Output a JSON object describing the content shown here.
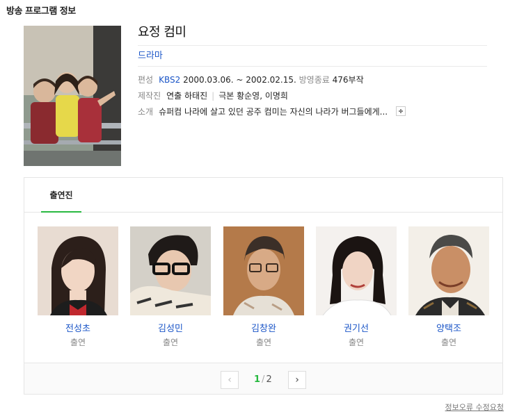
{
  "section_title": "방송 프로그램 정보",
  "program": {
    "title": "요정 컴미",
    "genre": "드라마",
    "broadcast": {
      "label": "편성",
      "channel": "KBS2",
      "period": "2000.03.06. ~ 2002.02.15.",
      "status": "방영종료",
      "episodes": "476부작"
    },
    "production": {
      "label": "제작진",
      "director": "연출 하태진",
      "writer": "극본 황순영, 이명희"
    },
    "synopsis": {
      "label": "소개",
      "text": "슈퍼컴 나라에 살고 있던 공주 컴미는 자신의 나라가 버그들에게..."
    }
  },
  "cast": {
    "tab_label": "출연진",
    "members": [
      {
        "name": "전성초",
        "role": "출연"
      },
      {
        "name": "김성민",
        "role": "출연"
      },
      {
        "name": "김창완",
        "role": "출연"
      },
      {
        "name": "권기선",
        "role": "출연"
      },
      {
        "name": "양택조",
        "role": "출연"
      }
    ],
    "pagination": {
      "current": "1",
      "separator": "/",
      "total": "2",
      "prev": "‹",
      "next": "›"
    }
  },
  "report_link": "정보오류 수정요청",
  "colors": {
    "link": "#1a55c7",
    "accent_green": "#28b940"
  }
}
